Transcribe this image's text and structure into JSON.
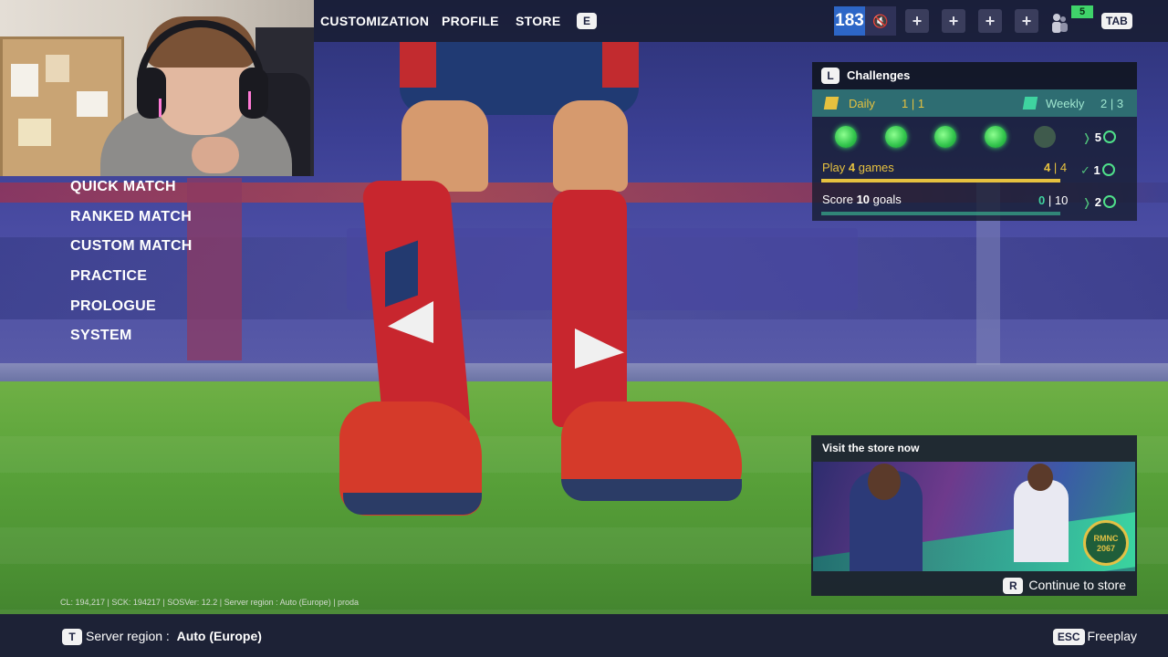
{
  "topbar": {
    "nav": [
      "CUSTOMIZATION",
      "PROFILE",
      "STORE"
    ],
    "nav_key": "E",
    "level": "183",
    "friends_count": "5",
    "tab_key": "TAB",
    "plus_label": "+"
  },
  "main_menu": {
    "items": [
      "QUICK MATCH",
      "RANKED MATCH",
      "CUSTOM MATCH",
      "PRACTICE",
      "PROLOGUE",
      "SYSTEM"
    ]
  },
  "challenges": {
    "key": "L",
    "title": "Challenges",
    "daily_label": "Daily",
    "daily_count": "1 | 1",
    "weekly_label": "Weekly",
    "weekly_count": "2 | 3",
    "dots_done": 4,
    "dots_total": 5,
    "streak_reward": "5",
    "rows": [
      {
        "prefix": "Play ",
        "number": "4",
        "suffix": " games",
        "progress_done": "4",
        "progress_total": "| 4",
        "reward": "1",
        "progress": 1.0,
        "color": "#e6c13f"
      },
      {
        "prefix": "Score ",
        "number": "10",
        "suffix": " goals",
        "progress_done": "0",
        "progress_total": "| 10",
        "reward": "2",
        "progress": 0.0,
        "color": "#3fd3a0"
      }
    ]
  },
  "store_promo": {
    "title": "Visit the store now",
    "logo_text": "RMNC 2067",
    "key": "R",
    "cta": "Continue to store"
  },
  "build_info": "CL: 194,217 | SCK: 194217 | SOSVer: 12.2 | Server region : Auto (Europe) | proda",
  "footer": {
    "region_key": "T",
    "region_label": "Server region :",
    "region_value": "Auto (Europe)",
    "freeplay_key": "ESC",
    "freeplay_label": "Freeplay"
  },
  "colors": {
    "accent_green": "#3fd36a",
    "level_blue": "#2d66c7",
    "daily_yellow": "#e6c13f",
    "tab_teal": "#2e6d72"
  }
}
